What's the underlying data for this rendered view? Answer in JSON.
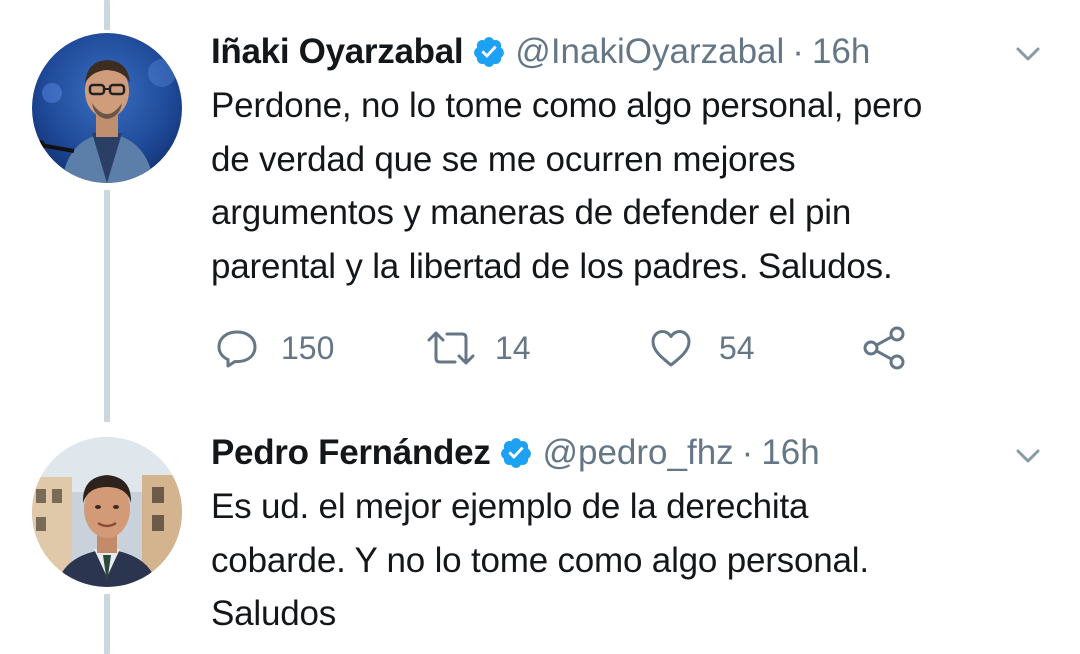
{
  "tweets": [
    {
      "display_name": "Iñaki Oyarzabal",
      "handle": "@InakiOyarzabal",
      "separator": "·",
      "time": "16h",
      "body_lines": [
        "Perdone, no lo tome como algo personal, pero",
        "de verdad que se me ocurren mejores",
        "argumentos y maneras de defender el pin",
        "parental y la libertad de los padres. Saludos."
      ],
      "replies": "150",
      "retweets": "14",
      "likes": "54"
    },
    {
      "display_name": "Pedro Fernández",
      "handle": "@pedro_fhz",
      "separator": "·",
      "time": "16h",
      "body_lines": [
        "Es ud. el mejor ejemplo de la derechita",
        "cobarde. Y no lo tome como algo personal.",
        "Saludos"
      ]
    }
  ],
  "colors": {
    "text_primary": "#14171a",
    "text_secondary": "#657786",
    "verified_blue": "#1da1f2",
    "thread_line": "#ccd6dd"
  },
  "icons": {
    "verified": "verified-badge-icon",
    "menu": "chevron-down-icon",
    "reply": "reply-icon",
    "retweet": "retweet-icon",
    "like": "heart-icon",
    "share": "share-icon"
  }
}
